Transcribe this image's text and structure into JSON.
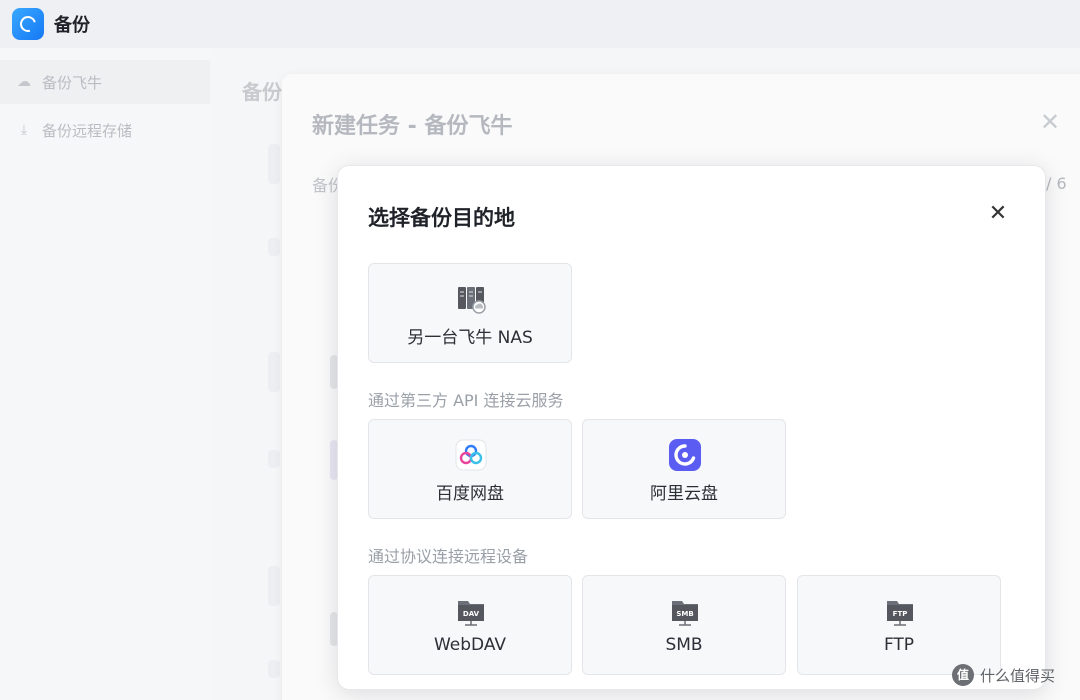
{
  "app": {
    "title": "备份",
    "icon": "backup-app-icon",
    "accent": "#1e88f5"
  },
  "sidebar": {
    "items": [
      {
        "label": "备份飞牛",
        "icon": "cloud-upload-icon",
        "active": true
      },
      {
        "label": "备份远程存储",
        "icon": "download-icon",
        "active": false
      }
    ]
  },
  "main": {
    "title": "备份"
  },
  "task_dialog": {
    "title": "新建任务 - 备份飞牛",
    "label": "备份",
    "step": "/ 6"
  },
  "destination_modal": {
    "title": "选择备份目的地",
    "close_icon": "close-icon",
    "nas_option": {
      "label": "另一台飞牛 NAS",
      "icon": "nas-server-icon"
    },
    "cloud_section": {
      "label": "通过第三方 API 连接云服务",
      "options": [
        {
          "label": "百度网盘",
          "icon": "baidu-netdisk-icon"
        },
        {
          "label": "阿里云盘",
          "icon": "aliyun-drive-icon"
        }
      ]
    },
    "protocol_section": {
      "label": "通过协议连接远程设备",
      "options": [
        {
          "label": "WebDAV",
          "icon": "webdav-icon",
          "badge": "DAV"
        },
        {
          "label": "SMB",
          "icon": "smb-icon",
          "badge": "SMB"
        },
        {
          "label": "FTP",
          "icon": "ftp-icon",
          "badge": "FTP"
        }
      ]
    }
  },
  "watermark": {
    "text": "什么值得买",
    "badge": "值"
  }
}
